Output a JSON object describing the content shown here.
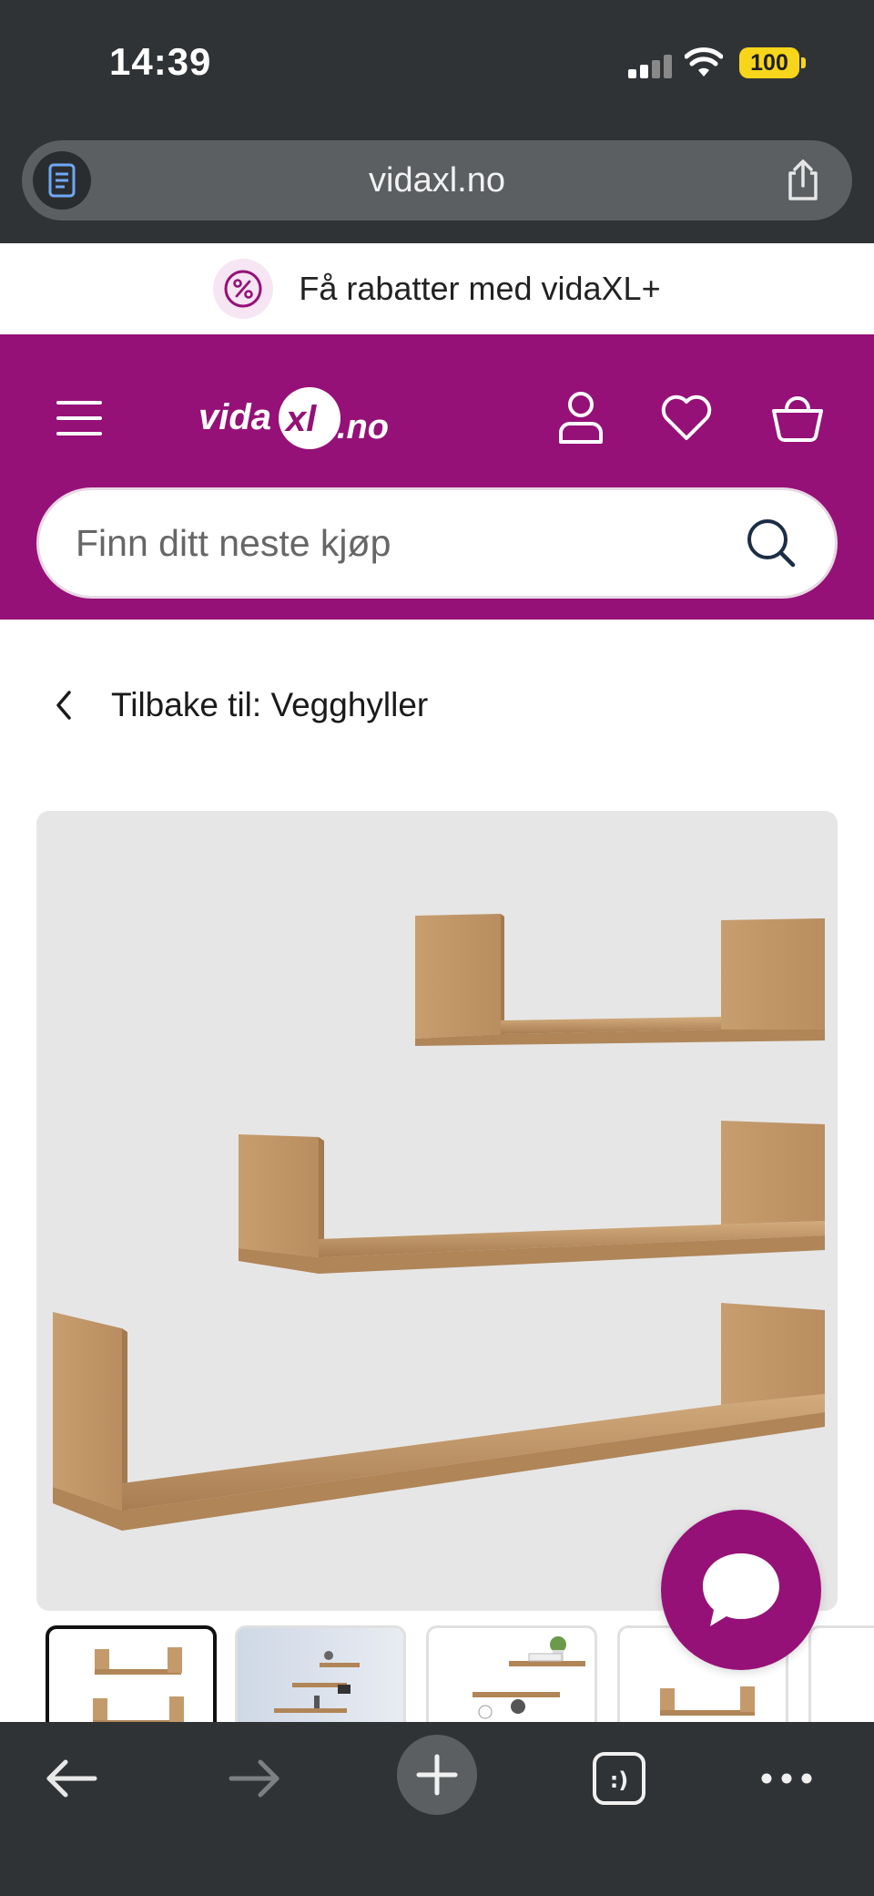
{
  "status_bar": {
    "time": "14:39",
    "battery": "100"
  },
  "browser": {
    "url": "vidaxl.no"
  },
  "promo": {
    "text": "Få rabatter med vidaXL+"
  },
  "header": {
    "logo_text": "vidaXL.no"
  },
  "search": {
    "placeholder": "Finn ditt neste kjøp"
  },
  "breadcrumb": {
    "back_label": "Tilbake til: Vegghyller"
  },
  "colors": {
    "brand": "#951177",
    "wood": "#c49a6c",
    "browser_chrome": "#303335"
  },
  "icons": {
    "reader": "reader-mode-icon",
    "share": "share-icon",
    "promo": "percent-badge-icon",
    "menu": "hamburger-menu-icon",
    "account": "user-icon",
    "wishlist": "heart-icon",
    "cart": "basket-icon",
    "search": "search-icon",
    "back": "chevron-left-icon",
    "chat": "chat-bubble-icon",
    "nav_back": "arrow-left-icon",
    "nav_forward": "arrow-right-icon",
    "new_tab": "plus-icon",
    "tabs": "tabs-icon",
    "more": "more-dots-icon"
  }
}
